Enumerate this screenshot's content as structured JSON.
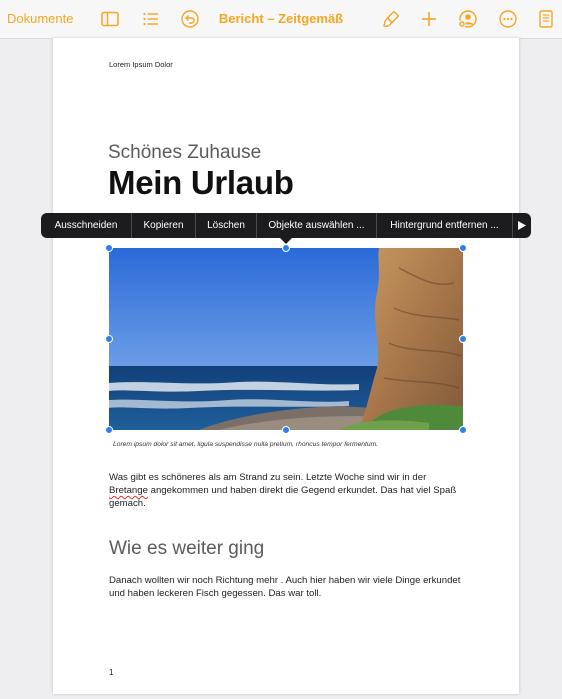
{
  "toolbar": {
    "back_label": "Dokumente",
    "doc_title": "Bericht – Zeitgemäß",
    "accent_color": "#f5a623",
    "icons": [
      "sidebar-icon",
      "list-icon",
      "undo-icon",
      "paintbrush-icon",
      "plus-icon",
      "collaborate-icon",
      "more-icon",
      "document-view-icon"
    ]
  },
  "document": {
    "header_text": "Lorem Ipsum Dolor",
    "subtitle": "Schönes Zuhause",
    "title": "Mein Urlaub",
    "caption": "Lorem ipsum dolor sit amet, ligula suspendisse nulla pretium, rhoncus tempor fermentum.",
    "paragraph1_start": "Was gibt es schöneres als am Strand zu sein. Letzte Woche sind wir in der ",
    "paragraph1_misspelled": "Bretange",
    "paragraph1_end": " angekommen und haben direkt die Gegend erkundet. Das hat viel Spaß gemach.",
    "heading2": "Wie es weiter ging",
    "paragraph2": "Danach wollten wir noch Richtung mehr . Auch hier haben wir viele Dinge erkundet und haben leckeren Fisch gegessen. Das war toll.",
    "page_number": "1"
  },
  "context_menu": {
    "items": [
      "Ausschneiden",
      "Kopieren",
      "Löschen",
      "Objekte auswählen ...",
      "Hintergrund entfernen ..."
    ],
    "more_icon": "play-arrow-icon"
  },
  "image": {
    "description_icon": "beach-cliff-photo"
  }
}
